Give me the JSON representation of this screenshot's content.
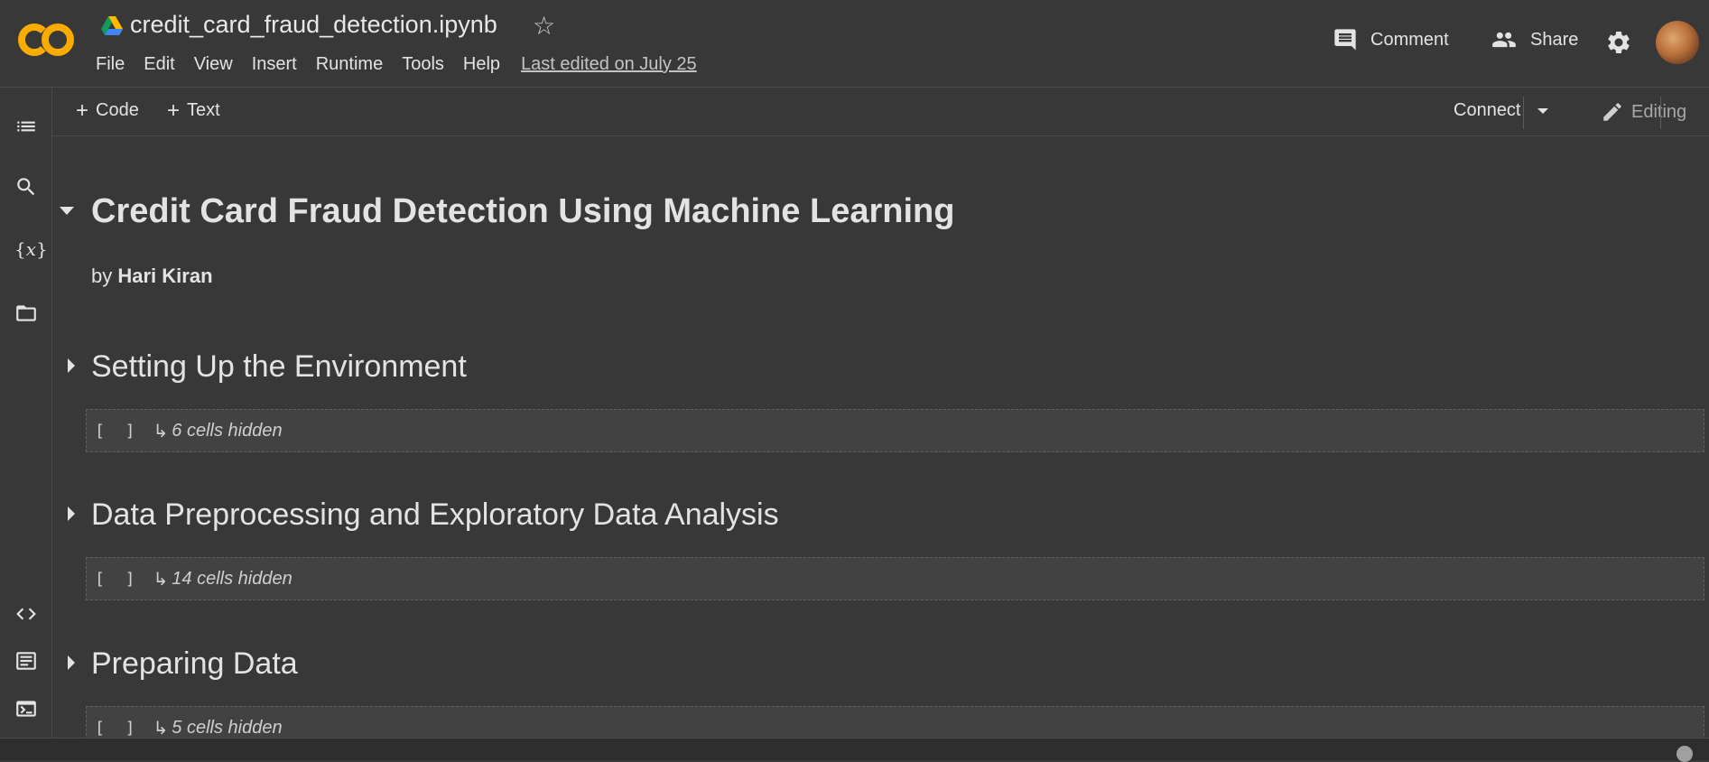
{
  "header": {
    "notebook_title": "credit_card_fraud_detection.ipynb",
    "logo_text": "CO",
    "menu": [
      "File",
      "Edit",
      "View",
      "Insert",
      "Runtime",
      "Tools",
      "Help"
    ],
    "last_edited": "Last edited on July 25",
    "comment_label": "Comment",
    "share_label": "Share"
  },
  "toolbar": {
    "add_code_label": "Code",
    "add_text_label": "Text",
    "connect_label": "Connect",
    "editing_label": "Editing"
  },
  "notebook": {
    "title": "Credit Card Fraud Detection Using Machine Learning",
    "byline_prefix": "by",
    "author": "Hari Kiran",
    "sections": [
      {
        "heading": "Setting Up the Environment",
        "hidden_cells": "6 cells hidden"
      },
      {
        "heading": "Data Preprocessing and Exploratory Data Analysis",
        "hidden_cells": "14 cells hidden"
      },
      {
        "heading": "Preparing Data",
        "hidden_cells": "5 cells hidden"
      }
    ],
    "cell_brackets": "[ ]"
  },
  "colors": {
    "background": "#383838",
    "logo_orange": "#f9ab00",
    "logo_orange_dark": "#e37400",
    "text": "#e3e3e3"
  }
}
